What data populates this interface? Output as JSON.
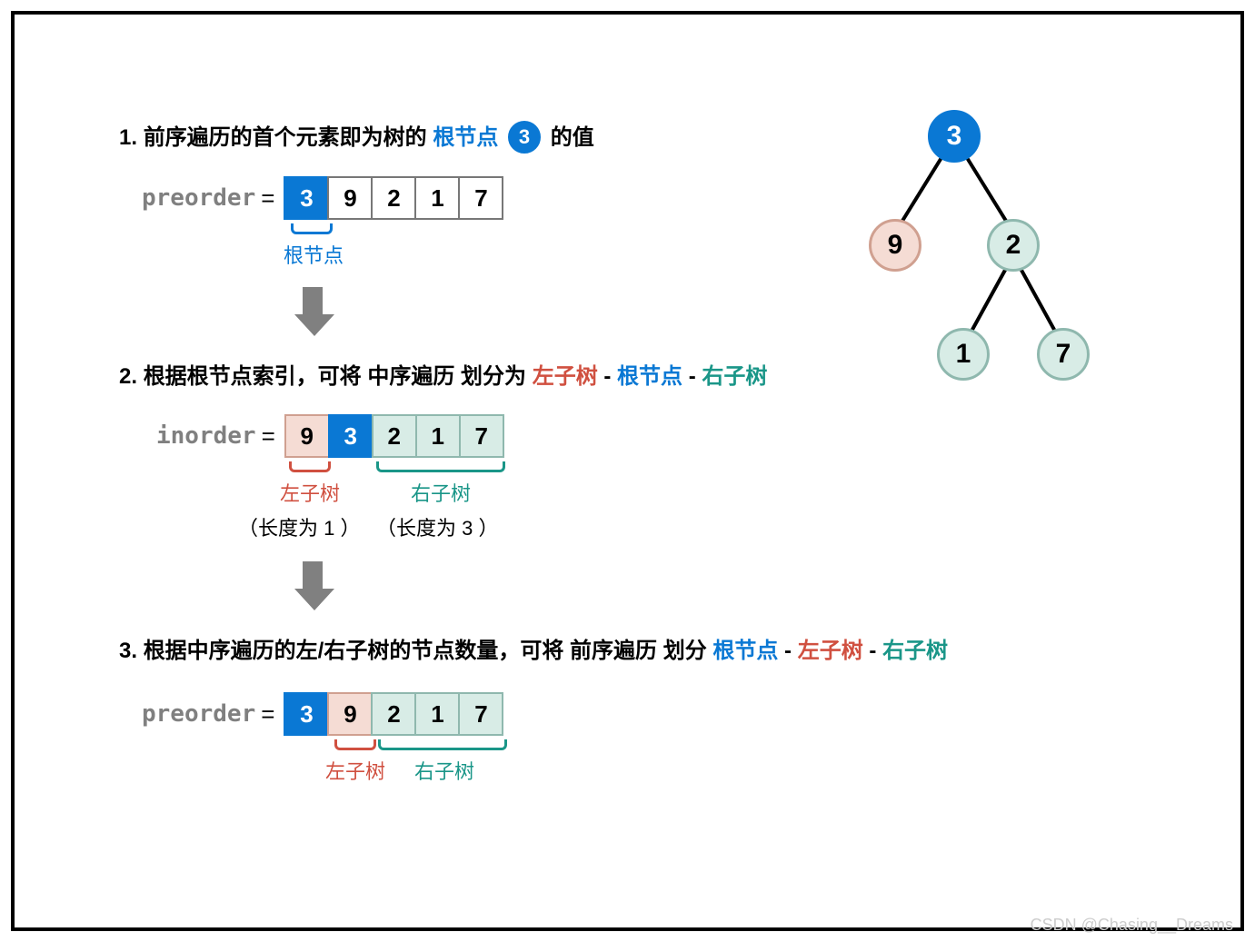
{
  "watermark": "CSDN @Chasing__Dreams",
  "steps": {
    "s1": {
      "num": "1.",
      "pre": "前序遍历的首个元素即为树的 ",
      "root_label": "根节点",
      "root_value": "3",
      "post": " 的值"
    },
    "s2": {
      "num": "2.",
      "pre": "根据根节点索引，可将 ",
      "bold": "中序遍历",
      "mid": " 划分为 ",
      "left": "左子树",
      "dash1": "-",
      "root": "根节点",
      "dash2": "-",
      "right": "右子树"
    },
    "s3": {
      "num": "3.",
      "pre": "根据中序遍历的左/右子树的节点数量，可将 ",
      "bold": "前序遍历",
      "mid": " 划分 ",
      "root": "根节点",
      "dash1": "-",
      "left": "左子树",
      "dash2": "-",
      "right": "右子树"
    }
  },
  "arrays": {
    "preorder1": {
      "label": "preorder",
      "cells": [
        "3",
        "9",
        "2",
        "1",
        "7"
      ],
      "root_ann": "根节点"
    },
    "inorder": {
      "label": "inorder",
      "cells": [
        "9",
        "3",
        "2",
        "1",
        "7"
      ],
      "left_ann": "左子树",
      "right_ann": "右子树",
      "len1": "（长度为 1 ）",
      "len2": "（长度为 3 ）"
    },
    "preorder2": {
      "label": "preorder",
      "cells": [
        "3",
        "9",
        "2",
        "1",
        "7"
      ],
      "left_ann": "左子树",
      "right_ann": "右子树"
    }
  },
  "tree": {
    "root": "3",
    "left": "9",
    "right": "2",
    "right_left": "1",
    "right_right": "7"
  }
}
